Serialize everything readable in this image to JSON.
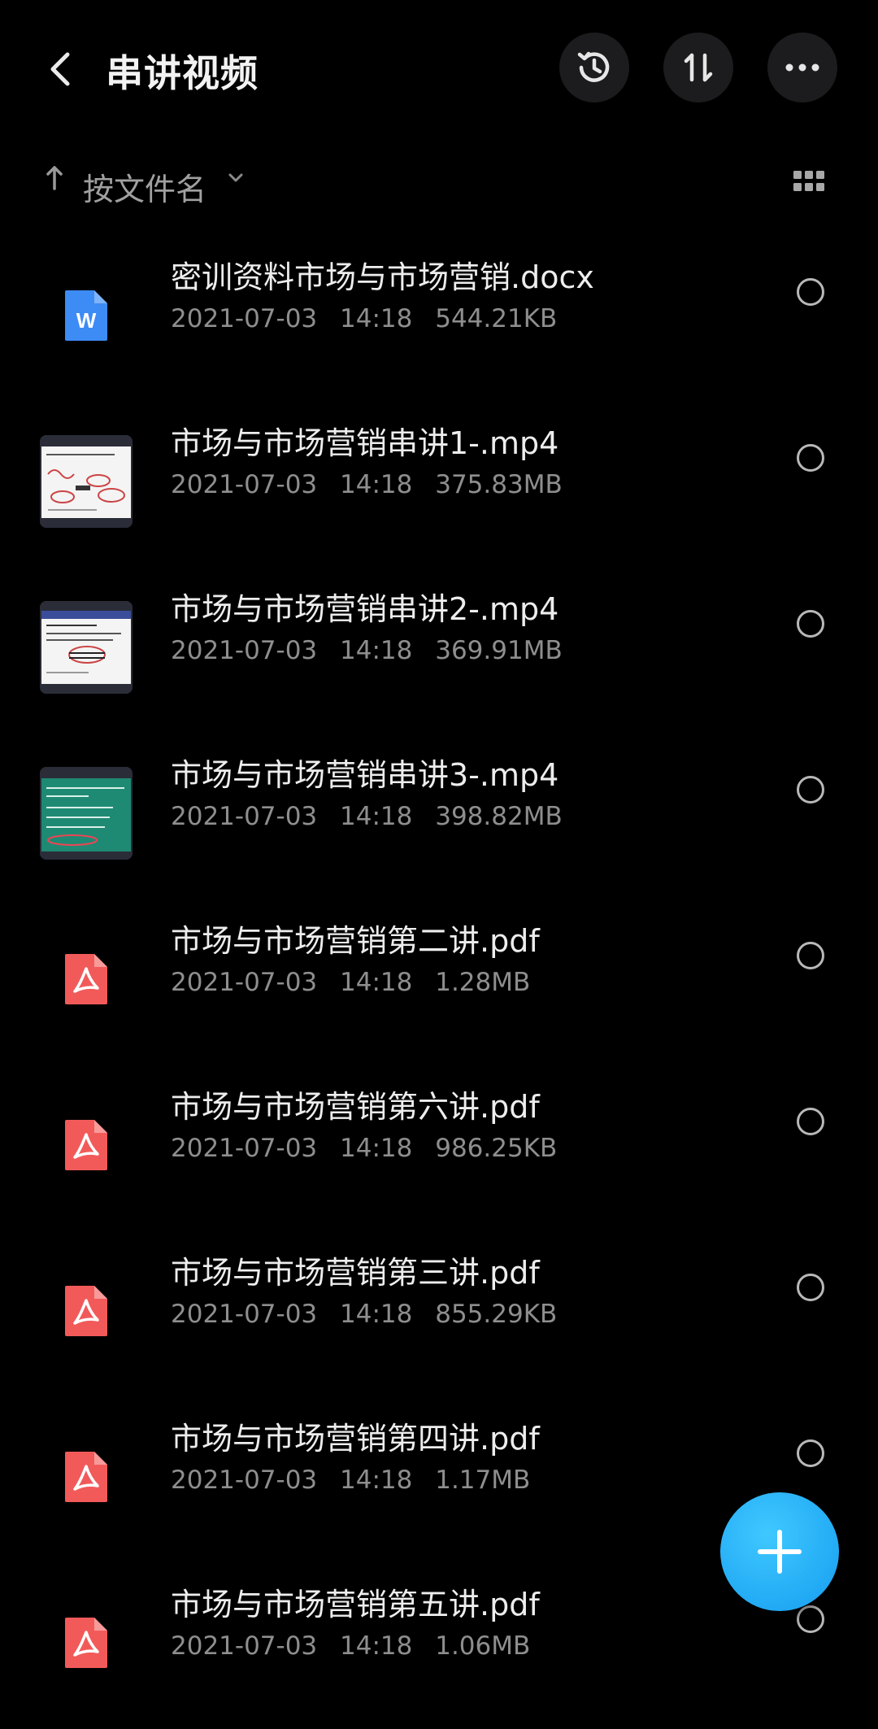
{
  "header": {
    "title": "串讲视频"
  },
  "sortbar": {
    "label": "按文件名"
  },
  "files": [
    {
      "name": "密训资料市场与市场营销.docx",
      "date": "2021-07-03",
      "time": "14:18",
      "size": "544.21KB",
      "type": "word-icon"
    },
    {
      "name": "市场与市场营销串讲1-.mp4",
      "date": "2021-07-03",
      "time": "14:18",
      "size": "375.83MB",
      "type": "video-thumbnail"
    },
    {
      "name": "市场与市场营销串讲2-.mp4",
      "date": "2021-07-03",
      "time": "14:18",
      "size": "369.91MB",
      "type": "video-thumbnail"
    },
    {
      "name": "市场与市场营销串讲3-.mp4",
      "date": "2021-07-03",
      "time": "14:18",
      "size": "398.82MB",
      "type": "video-thumbnail"
    },
    {
      "name": "市场与市场营销第二讲.pdf",
      "date": "2021-07-03",
      "time": "14:18",
      "size": "1.28MB",
      "type": "pdf-icon"
    },
    {
      "name": "市场与市场营销第六讲.pdf",
      "date": "2021-07-03",
      "time": "14:18",
      "size": "986.25KB",
      "type": "pdf-icon"
    },
    {
      "name": "市场与市场营销第三讲.pdf",
      "date": "2021-07-03",
      "time": "14:18",
      "size": "855.29KB",
      "type": "pdf-icon"
    },
    {
      "name": "市场与市场营销第四讲.pdf",
      "date": "2021-07-03",
      "time": "14:18",
      "size": "1.17MB",
      "type": "pdf-icon"
    },
    {
      "name": "市场与市场营销第五讲.pdf",
      "date": "2021-07-03",
      "time": "14:18",
      "size": "1.06MB",
      "type": "pdf-icon"
    }
  ],
  "colors": {
    "background": "#000000",
    "word_blue": "#3d8bf5",
    "pdf_red": "#f25a5a",
    "fab_blue": "#1ba8f5"
  }
}
